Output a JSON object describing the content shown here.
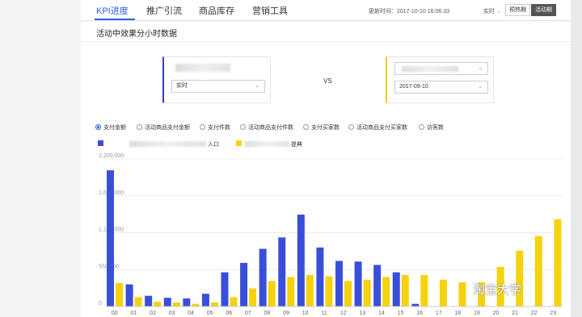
{
  "nav": {
    "tabs": [
      {
        "label": "KPI进度"
      },
      {
        "label": "推广引流"
      },
      {
        "label": "商品库存"
      },
      {
        "label": "营销工具"
      }
    ],
    "update_time": "更新时间：2017-10-10 16:06:33",
    "realtime_toggle": "实时",
    "pre_phase": "预热期",
    "active_phase": "活动期"
  },
  "section": {
    "title": "活动中效果分小时数据"
  },
  "compare": {
    "left_select": "实时",
    "vs": "VS",
    "right_date": "2017-09-10"
  },
  "metrics": [
    "支付金额",
    "活动商品支付金额",
    "支付件数",
    "活动商品支付件数",
    "支付买家数",
    "活动商品支付买家数",
    "访客数"
  ],
  "legend": {
    "left": "入口",
    "right": "提典"
  },
  "colors": {
    "blue": "#3a4fd8",
    "yellow": "#f5d20d"
  },
  "watermark": "淘宝大学",
  "chart_data": {
    "type": "bar",
    "categories": [
      "00",
      "01",
      "02",
      "03",
      "04",
      "05",
      "06",
      "07",
      "08",
      "09",
      "10",
      "11",
      "12",
      "13",
      "14",
      "15",
      "16",
      "17",
      "18",
      "19",
      "20",
      "21",
      "22",
      "23"
    ],
    "ytick_labels": [
      "2,200,000",
      "1,650,000",
      "1,100,000",
      "550,000",
      "0"
    ],
    "ylim": [
      0,
      2200000
    ],
    "series": [
      {
        "name": "入口",
        "color": "#3a4fd8",
        "values": [
          2030000,
          330000,
          160000,
          130000,
          120000,
          190000,
          510000,
          650000,
          860000,
          1030000,
          1370000,
          880000,
          680000,
          670000,
          620000,
          510000,
          40000,
          0,
          0,
          0,
          0,
          0,
          0,
          0
        ]
      },
      {
        "name": "提典",
        "color": "#f5d20d",
        "values": [
          350000,
          140000,
          70000,
          60000,
          40000,
          60000,
          140000,
          270000,
          380000,
          440000,
          470000,
          450000,
          380000,
          400000,
          440000,
          470000,
          470000,
          400000,
          360000,
          360000,
          590000,
          830000,
          1050000,
          1300000
        ]
      }
    ]
  }
}
